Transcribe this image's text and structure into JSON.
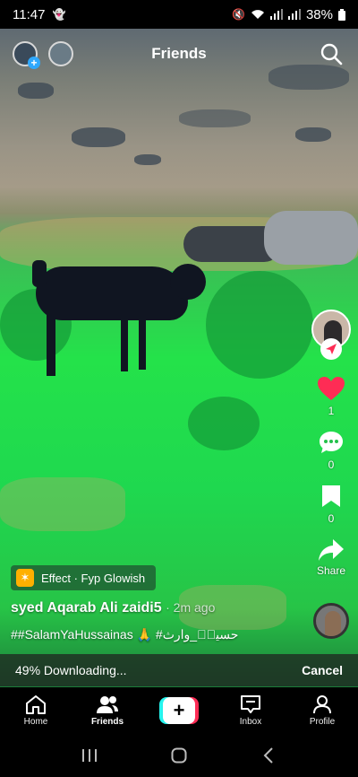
{
  "status_bar": {
    "time": "11:47",
    "battery": "38%"
  },
  "top_nav": {
    "title": "Friends"
  },
  "rail": {
    "likes": "1",
    "comments": "0",
    "saves": "0",
    "share_label": "Share"
  },
  "effect": {
    "label": "Effect · Fyp Glowish"
  },
  "post": {
    "author": "syed Aqarab Ali zaidi5",
    "time": "· 2m ago",
    "hashtags": "##SalamYaHussainas 🙏 #حسینؑ_وارث"
  },
  "download": {
    "status": "49% Downloading...",
    "cancel_label": "Cancel"
  },
  "bottom_nav": {
    "items": [
      {
        "label": "Home",
        "icon": "home-icon"
      },
      {
        "label": "Friends",
        "icon": "friends-icon"
      },
      {
        "label": "",
        "icon": "create-icon"
      },
      {
        "label": "Inbox",
        "icon": "inbox-icon"
      },
      {
        "label": "Profile",
        "icon": "profile-icon"
      }
    ]
  },
  "colors": {
    "like": "#fe2c55",
    "accent_cyan": "#25f4ee",
    "effect_badge": "#ffb000"
  }
}
